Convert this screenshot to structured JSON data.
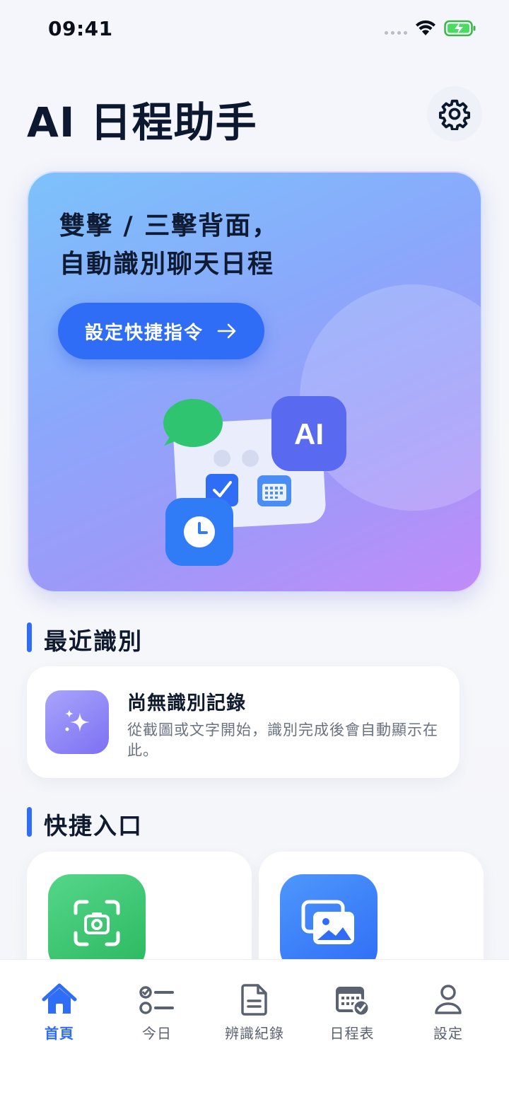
{
  "status_bar": {
    "time": "09:41"
  },
  "header": {
    "title": "AI 日程助手"
  },
  "hero": {
    "line1": "雙擊 / 三擊背面，",
    "line2": "自動識別聊天日程",
    "cta_label": "設定快捷指令",
    "ai_badge": "AI"
  },
  "recent": {
    "section_title": "最近識別",
    "empty_title": "尚無識別記錄",
    "empty_desc": "從截圖或文字開始，識別完成後會自動顯示在此。"
  },
  "quick": {
    "section_title": "快捷入口",
    "items": [
      {
        "icon": "camera-scan-icon",
        "color": "#3ec46d"
      },
      {
        "icon": "photos-icon",
        "color": "#2f6df6"
      }
    ]
  },
  "tabs": [
    {
      "label": "首頁",
      "icon": "home-icon",
      "active": true
    },
    {
      "label": "今日",
      "icon": "checklist-icon",
      "active": false
    },
    {
      "label": "辨識紀錄",
      "icon": "document-icon",
      "active": false
    },
    {
      "label": "日程表",
      "icon": "calendar-check-icon",
      "active": false
    },
    {
      "label": "設定",
      "icon": "person-icon",
      "active": false
    }
  ],
  "colors": {
    "accent": "#2f6df6",
    "title": "#0c1830",
    "muted": "#6a7282"
  }
}
